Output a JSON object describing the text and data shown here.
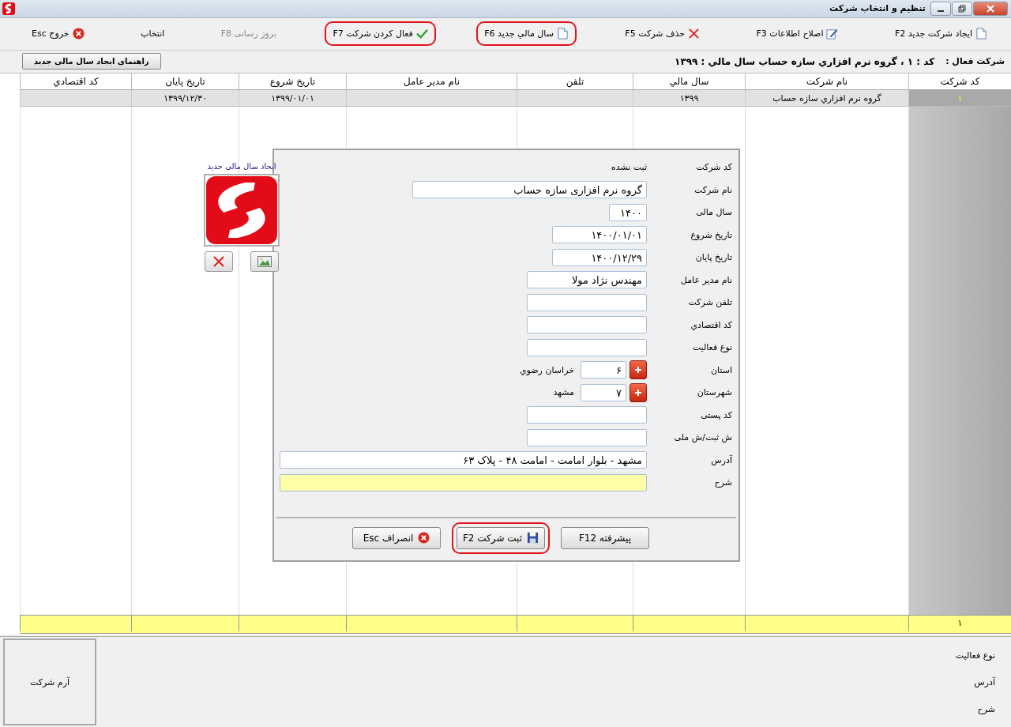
{
  "window": {
    "title": "تنظیم و انتخاب شرکت"
  },
  "toolbar": [
    {
      "label": "ایجاد شرکت جدید F2",
      "kind": "document",
      "highlighted": false,
      "disabled": false
    },
    {
      "label": "اصلاح اطلاعات F3",
      "kind": "edit",
      "highlighted": false,
      "disabled": false
    },
    {
      "label": "حذف شرکت F5",
      "kind": "delete",
      "highlighted": false,
      "disabled": false
    },
    {
      "label": "سال مالي جديد F6",
      "kind": "document",
      "highlighted": true,
      "disabled": false
    },
    {
      "label": "فعال کردن شرکت F7",
      "kind": "check",
      "highlighted": true,
      "disabled": false
    },
    {
      "label": "بروز رسانی F8",
      "kind": "plain",
      "highlighted": false,
      "disabled": true
    },
    {
      "label": "انتخاب",
      "kind": "plain",
      "highlighted": false,
      "disabled": false
    },
    {
      "label": "خروج Esc",
      "kind": "exit",
      "highlighted": false,
      "disabled": false
    }
  ],
  "active_company": {
    "label": "شرکت فعال :",
    "value": "کد : ۱ ، گروه نرم افزاري سازه حساب سال مالي : ۱۳۹۹",
    "help_button": "راهنمای ایجاد سال مالی جدید"
  },
  "table": {
    "columns": [
      "کد شرکت",
      "نام شرکت",
      "سال مالي",
      "تلفن",
      "نام مدير عامل",
      "تاريخ شروع",
      "تاريخ پايان",
      "کد اقتصادي"
    ],
    "rows": [
      {
        "selected": true,
        "cells": [
          "۱",
          "گروه نرم افزاري سازه حساب",
          "۱۳۹۹",
          null,
          null,
          "۱۳۹۹/۰۱/۰۱",
          "۱۳۹۹/۱۲/۳۰",
          null
        ]
      }
    ],
    "footer": {
      "count": "۱"
    }
  },
  "dialog": {
    "image_caption": "ایجاد سال مالی جدید",
    "fields": [
      {
        "kind": "static",
        "label": "کد شرکت",
        "value": "ثبت نشده"
      },
      {
        "kind": "input",
        "label": "نام شرکت",
        "value": "گروه نرم افزاری سازه حساب"
      },
      {
        "kind": "input",
        "label": "سال مالی",
        "value": "۱۴۰۰"
      },
      {
        "kind": "input",
        "label": "تاریخ شروع",
        "value": "۱۴۰۰/۰۱/۰۱"
      },
      {
        "kind": "input",
        "label": "تاریخ پایان",
        "value": "۱۴۰۰/۱۲/۲۹"
      },
      {
        "kind": "input",
        "label": "نام مدیر عامل",
        "value": "مهندس نژاد مولا"
      },
      {
        "kind": "input",
        "label": "تلفن شرکت"
      },
      {
        "kind": "input",
        "label": "کد اقتصادي"
      },
      {
        "kind": "input",
        "label": "نوع فعالیت"
      },
      {
        "kind": "lookup",
        "label": "استان",
        "value": "۶",
        "caption": "خراسان رضوي"
      },
      {
        "kind": "lookup",
        "label": "شهرستان",
        "value": "۷",
        "caption": "مشهد"
      },
      {
        "kind": "input",
        "label": "کد پستی"
      },
      {
        "kind": "input",
        "label": "ش ثبت/ش ملی"
      },
      {
        "kind": "input",
        "label": "آدرس",
        "value": "مشهد - بلوار امامت - امامت ۴۸ - پلاک ۶۳"
      },
      {
        "kind": "input",
        "label": "شرح",
        "highlighted": true
      }
    ],
    "buttons": [
      {
        "label": "پیشرفته F12",
        "kind": "plain",
        "highlighted": false
      },
      {
        "label": "ثبت شرکت F2",
        "kind": "save",
        "highlighted": true
      },
      {
        "label": "انصراف Esc",
        "kind": "exit",
        "highlighted": false
      }
    ]
  },
  "details": {
    "logo_label": "آرم شرکت",
    "labels": [
      "نوع فعالیت",
      "آدرس",
      "شرح"
    ]
  }
}
